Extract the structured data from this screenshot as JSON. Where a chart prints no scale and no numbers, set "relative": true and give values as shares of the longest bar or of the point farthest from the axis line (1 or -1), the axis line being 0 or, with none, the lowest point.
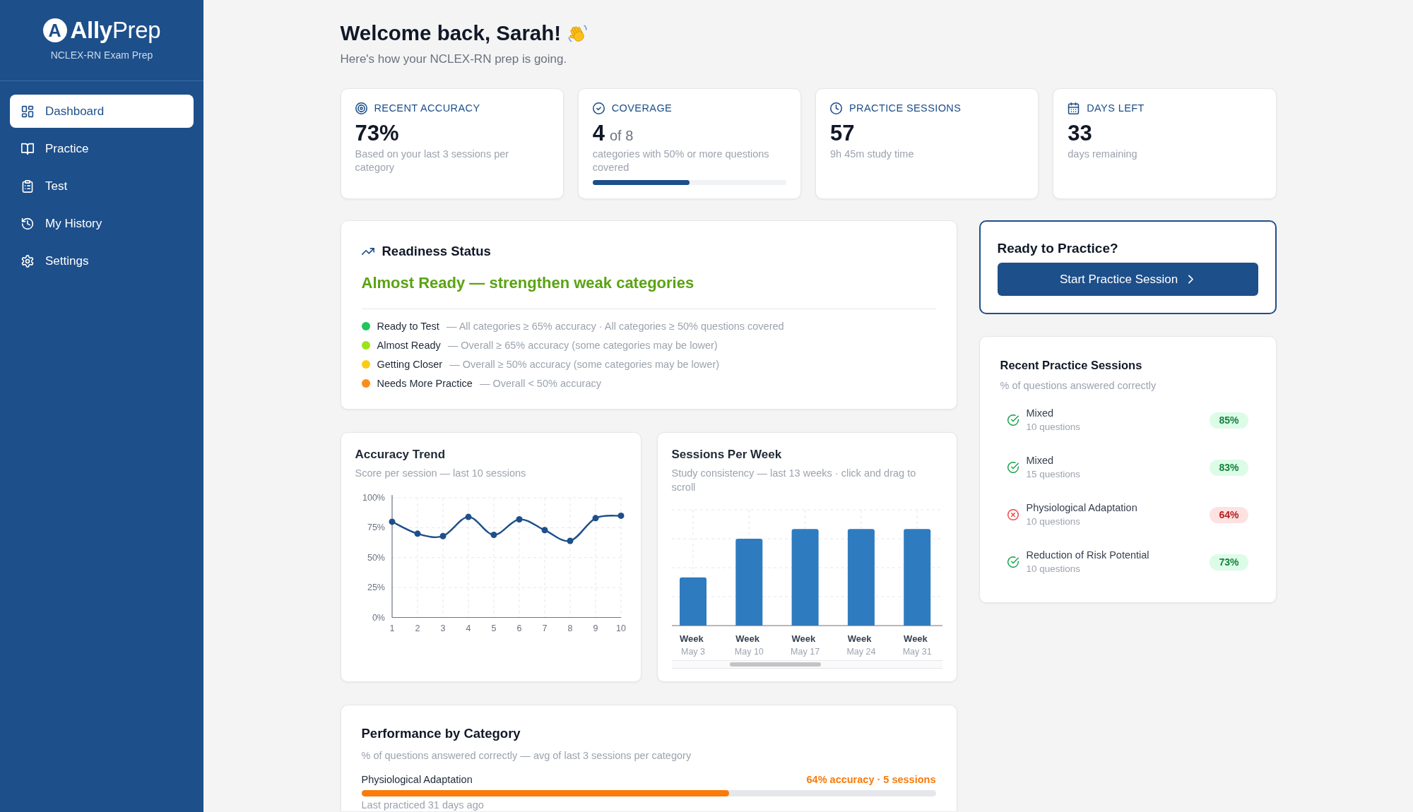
{
  "sidebar": {
    "logo": {
      "mark": "A",
      "wordmark": "**Ally**Prep"
    },
    "tagline": "NCLEX-RN Exam Prep",
    "nav": [
      {
        "label": "Dashboard",
        "selected": true
      },
      {
        "label": "Practice",
        "selected": false
      },
      {
        "label": "Test",
        "selected": false
      },
      {
        "label": "My History",
        "selected": false
      },
      {
        "label": "Settings",
        "selected": false
      }
    ]
  },
  "header": {
    "title": "Welcome back, Sarah!",
    "subtitle": "Here's how your NCLEX-RN prep is going."
  },
  "stats": [
    {
      "label": "RECENT ACCURACY",
      "value": "73%",
      "note": "Based on your last 3 sessions per category"
    },
    {
      "label": "COVERAGE",
      "value": "4",
      "value_suffix": "of 8",
      "note": "categories with 50% or more questions covered",
      "level": 0.5
    },
    {
      "label": "PRACTICE SESSIONS",
      "value": "57",
      "note": "9h 45m study time"
    },
    {
      "label": "DAYS LEFT",
      "value": "33",
      "note": "days remaining"
    }
  ],
  "readiness": {
    "title": "Readiness Status",
    "headline": "Almost Ready — strengthen weak categories",
    "legend": [
      {
        "label": "Ready to Test",
        "description": "— All categories ≥ 65% accuracy · All categories ≥ 50% questions covered",
        "color": "#22c55e"
      },
      {
        "label": "Almost Ready",
        "description": "— Overall ≥ 65% accuracy (some categories may be lower)",
        "color": "#9ee31a"
      },
      {
        "label": "Getting Closer",
        "description": "— Overall ≥ 50% accuracy (some categories may be lower)",
        "color": "#facc15"
      },
      {
        "label": "Needs More Practice",
        "description": "— Overall < 50% accuracy",
        "color": "#fb8c1a"
      }
    ]
  },
  "practice_cta": {
    "title": "Ready to Practice?",
    "button": "Start Practice Session"
  },
  "recent_sessions": {
    "title": "Recent Practice Sessions",
    "subtitle": "% of questions answered correctly",
    "sessions": [
      {
        "name": "Mixed",
        "questions": "10 questions",
        "score": "85%",
        "passed": true
      },
      {
        "name": "Mixed",
        "questions": "15 questions",
        "score": "83%",
        "passed": true
      },
      {
        "name": "Physiological Adaptation",
        "questions": "10 questions",
        "score": "64%",
        "passed": false
      },
      {
        "name": "Reduction of Risk Potential",
        "questions": "10 questions",
        "score": "73%",
        "passed": true
      }
    ]
  },
  "accuracy_trend": {
    "title": "Accuracy Trend",
    "subtitle": "Score per session — last 10 sessions",
    "chart_data": {
      "type": "line",
      "categories": [
        "1",
        "2",
        "3",
        "4",
        "5",
        "6",
        "7",
        "8",
        "9",
        "10"
      ],
      "values": [
        80,
        70,
        68,
        84,
        69,
        82,
        73,
        64,
        83,
        85
      ],
      "ylim": [
        0,
        100
      ],
      "yticks": [
        {
          "value": 0,
          "label": "0%"
        },
        {
          "value": 25,
          "label": "25%"
        },
        {
          "value": 50,
          "label": "50%"
        },
        {
          "value": 75,
          "label": "75%"
        },
        {
          "value": 100,
          "label": "100%"
        }
      ],
      "grid": true,
      "marker": true
    }
  },
  "sessions_per_week": {
    "title": "Sessions Per Week",
    "subtitle": "Study consistency — last 13 weeks · click and drag to scroll",
    "chart_data": {
      "type": "bar",
      "categories": [
        "Week\nMay 3",
        "Week\nMay 10",
        "Week\nMay 17",
        "Week\nMay 24",
        "Week\nMay 31"
      ],
      "values": [
        0.5,
        0.9,
        1,
        1,
        1
      ],
      "relative": true,
      "grid": true
    }
  },
  "performance": {
    "title": "Performance by Category",
    "subtitle": "% of questions answered correctly — avg of last 3 sessions per category",
    "categories": [
      {
        "name": "Physiological Adaptation",
        "summary": "64% accuracy · 5 sessions",
        "level": 0.64,
        "color": "#fa7a0a",
        "last_practiced": "Last practiced 31 days ago"
      }
    ]
  }
}
